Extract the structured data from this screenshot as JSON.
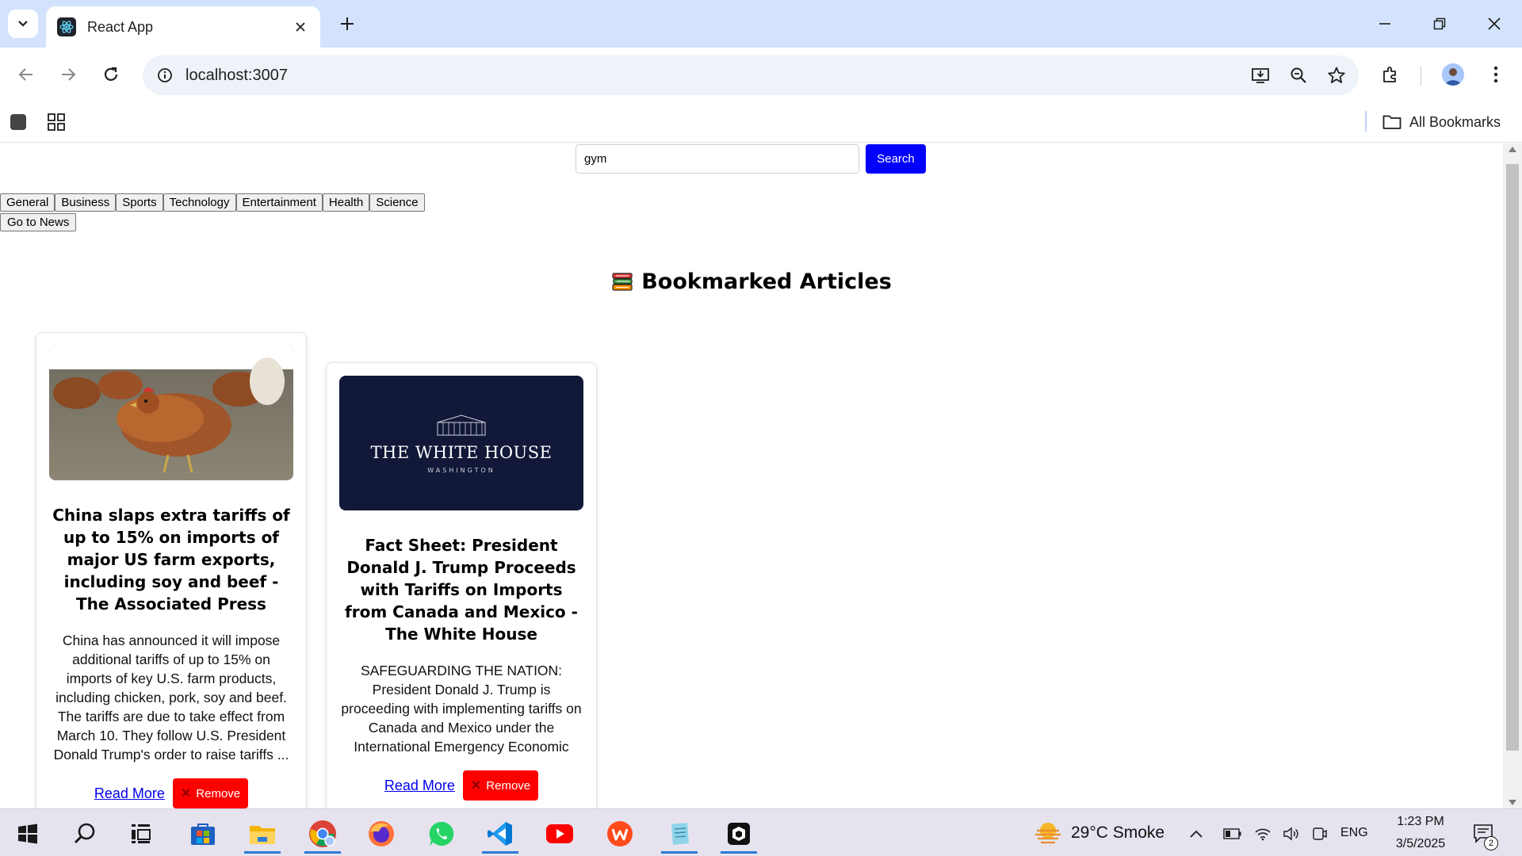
{
  "browser": {
    "tab_title": "React App",
    "url": "localhost:3007",
    "all_bookmarks_label": "All Bookmarks"
  },
  "page": {
    "search": {
      "value": "gym",
      "button_label": "Search"
    },
    "categories": [
      "General",
      "Business",
      "Sports",
      "Technology",
      "Entertainment",
      "Health",
      "Science"
    ],
    "go_to_news_label": "Go to News",
    "heading": "Bookmarked Articles",
    "articles": [
      {
        "title": "China slaps extra tariffs of up to 15% on imports of major US farm exports, including soy and beef - The Associated Press",
        "description": "China has announced it will impose additional tariffs of up to 15% on imports of key U.S. farm products, including chicken, pork, soy and beef. The tariffs are due to take effect from March 10. They follow U.S. President Donald Trump's order to raise tariffs ...",
        "read_more_label": "Read More",
        "remove_label": "Remove"
      },
      {
        "title": "Fact Sheet: President Donald J. Trump Proceeds with Tariffs on Imports from Canada and Mexico - The White House",
        "description": "SAFEGUARDING THE NATION: President Donald J. Trump is proceeding with implementing tariffs on Canada and Mexico under the International Emergency Economic",
        "image_text": "THE WHITE HOUSE",
        "image_subtext": "WASHINGTON",
        "read_more_label": "Read More",
        "remove_label": "Remove"
      }
    ]
  },
  "taskbar": {
    "weather": "29°C  Smoke",
    "language": "ENG",
    "time": "1:23 PM",
    "date": "3/5/2025",
    "notification_count": "2"
  },
  "colors": {
    "tabbar_bg": "#d3e3fd",
    "search_button": "#0000ff",
    "remove_button": "#ff0000",
    "link": "#0000ee",
    "whitehouse_bg": "#111838"
  }
}
